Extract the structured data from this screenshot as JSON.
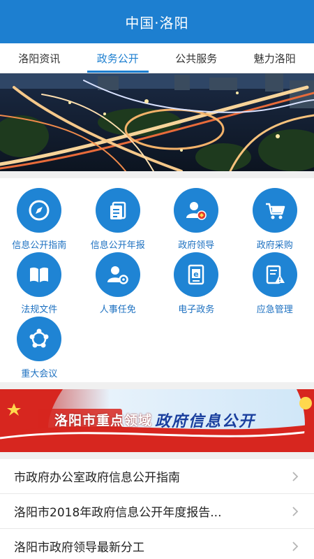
{
  "header": {
    "title": "中国·洛阳"
  },
  "tabs": [
    {
      "label": "洛阳资讯",
      "active": false
    },
    {
      "label": "政务公开",
      "active": true
    },
    {
      "label": "公共服务",
      "active": false
    },
    {
      "label": "魅力洛阳",
      "active": false
    }
  ],
  "banner": {
    "icon": "city-overpass-photo"
  },
  "grid": [
    {
      "label": "信息公开指南",
      "icon": "compass-icon"
    },
    {
      "label": "信息公开年报",
      "icon": "report-icon"
    },
    {
      "label": "政府领导",
      "icon": "leader-icon"
    },
    {
      "label": "政府采购",
      "icon": "cart-icon"
    },
    {
      "label": "法规文件",
      "icon": "book-icon"
    },
    {
      "label": "人事任免",
      "icon": "personnel-icon"
    },
    {
      "label": "电子政务",
      "icon": "e-gov-icon"
    },
    {
      "label": "应急管理",
      "icon": "emergency-icon"
    },
    {
      "label": "重大会议",
      "icon": "meeting-icon"
    }
  ],
  "promo": {
    "part1": "洛阳市重点领域",
    "part2": "政府信息公开"
  },
  "list": [
    {
      "text": "市政府办公室政府信息公开指南"
    },
    {
      "text": "洛阳市2018年政府信息公开年度报告..."
    },
    {
      "text": "洛阳市政府领导最新分工"
    }
  ],
  "colors": {
    "primary": "#1d7fd0",
    "icon_bg": "#1f84d4",
    "label": "#1c70c0",
    "promo_red": "#d7261f"
  }
}
